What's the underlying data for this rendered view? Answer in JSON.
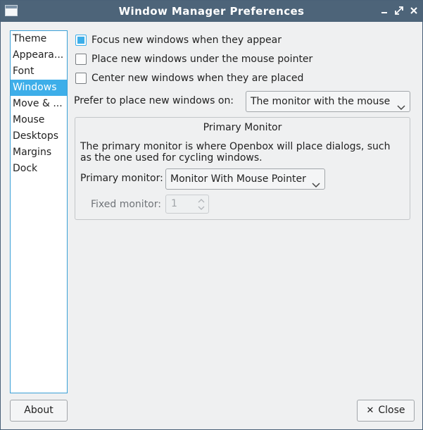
{
  "window": {
    "title": "Window Manager Preferences"
  },
  "titlebar_icons": [
    "app-icon",
    "minimize-icon",
    "restore-icon",
    "close-icon"
  ],
  "sidebar": {
    "items": [
      {
        "label": "Theme"
      },
      {
        "label": "Appeara..."
      },
      {
        "label": "Font"
      },
      {
        "label": "Windows",
        "selected": true
      },
      {
        "label": "Move & ..."
      },
      {
        "label": "Mouse"
      },
      {
        "label": "Desktops"
      },
      {
        "label": "Margins"
      },
      {
        "label": "Dock"
      }
    ]
  },
  "options": {
    "focus_new": {
      "label": "Focus new windows when they appear",
      "checked": true
    },
    "place_under_mouse": {
      "label": "Place new windows under the mouse pointer",
      "checked": false
    },
    "center_new": {
      "label": "Center new windows when they are placed",
      "checked": false
    }
  },
  "prefer": {
    "label": "Prefer to place new windows on:",
    "value": "The monitor with the mouse"
  },
  "primary_group": {
    "title": "Primary Monitor",
    "description": "The primary monitor is where Openbox will place dialogs, such as the one used for cycling windows.",
    "primary_label": "Primary monitor:",
    "primary_value": "Monitor With Mouse Pointer",
    "fixed_label": "Fixed monitor:",
    "fixed_value": "1"
  },
  "buttons": {
    "about": "About",
    "close": "Close"
  },
  "colors": {
    "accent": "#3daee9",
    "titlebar": "#4d6479"
  }
}
